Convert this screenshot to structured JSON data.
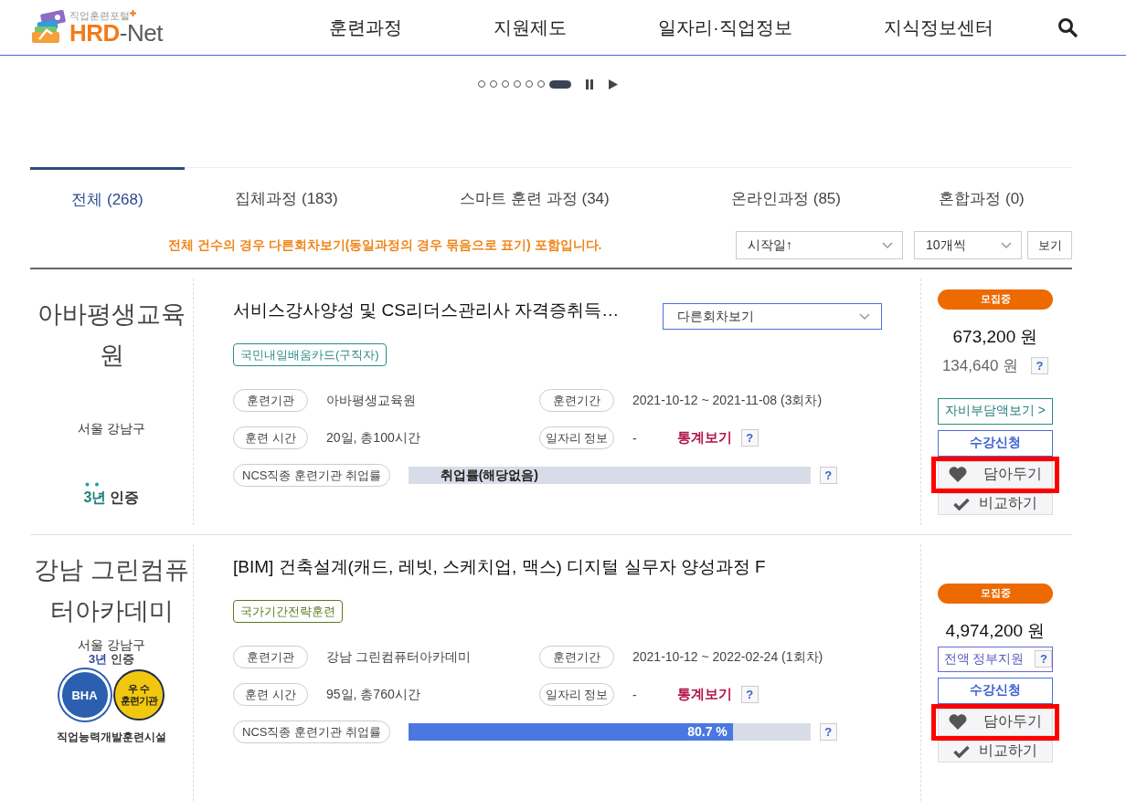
{
  "header": {
    "logo_subtitle": "직업훈련포털",
    "logo_brand": "HRD",
    "logo_suffix": "-Net",
    "nav": [
      "훈련과정",
      "지원제도",
      "일자리·직업정보",
      "지식정보센터"
    ]
  },
  "carousel": {
    "dots": [
      {
        "selected": false
      },
      {
        "selected": false
      },
      {
        "selected": false
      },
      {
        "selected": false
      },
      {
        "selected": false
      },
      {
        "selected": false
      },
      {
        "selected": true
      }
    ]
  },
  "tabs": [
    {
      "label": "전체 (268)",
      "selected": true
    },
    {
      "label": "집체과정 (183)",
      "selected": false
    },
    {
      "label": "스마트 훈련 과정 (34)",
      "selected": false
    },
    {
      "label": "온라인과정 (85)",
      "selected": false
    },
    {
      "label": "혼합과정 (0)",
      "selected": false
    }
  ],
  "notice": "전체 건수의 경우 다른회차보기(동일과정의 경우 묶음으로 표기) 포함입니다.",
  "sort": {
    "order": "시작일↑",
    "page_size": "10개씩",
    "button": "보기"
  },
  "courses": [
    {
      "institution": "아바평생교육원",
      "location": "서울 강남구",
      "certification": {
        "kind": "dotted",
        "years": "3년",
        "label": "인증"
      },
      "title": "서비스강사양성 및 CS리더스관리사 자격증취득…",
      "other_rounds": "다른회차보기",
      "tag": {
        "label": "국민내일배움카드(구직자)",
        "color": "#2b8a86"
      },
      "info": [
        {
          "label": "훈련기관",
          "value": "아바평생교육원"
        },
        {
          "label": "훈련기간",
          "value": "2021-10-12 ~ 2021-11-08 (3회차)"
        },
        {
          "label": "훈련 시간",
          "value": "20일, 총100시간"
        },
        {
          "label": "일자리 정보",
          "value": "-"
        }
      ],
      "stats_link": "통계보기",
      "stats_help": "?",
      "employment": {
        "label": "NCS직종 훈련기관 취업률",
        "level": 0,
        "reading": "취업률(해당없음)",
        "help": "?"
      },
      "status": "모집중",
      "price": "673,200 원",
      "self_pay": "134,640 원",
      "self_pay_help": "?",
      "self_pay_button": "자비부담액보기 >",
      "apply": "수강신청",
      "save": "담아두기",
      "compare": "비교하기",
      "highlighted": true
    },
    {
      "institution": "강남 그린컴퓨터아카데미",
      "location": "서울 강남구",
      "certification": {
        "kind": "plain",
        "years": "3년",
        "label": "인증"
      },
      "badges": [
        {
          "kind": "bha",
          "text": "BHA"
        },
        {
          "kind": "excellent",
          "text": "우 수\n훈련기관"
        }
      ],
      "facility": "직업능력개발훈련시설",
      "title": "[BIM] 건축설계(캐드, 레빗, 스케치업, 맥스) 디지털 실무자 양성과정 F",
      "tag": {
        "label": "국가기간전략훈련",
        "color": "#5b7a1f"
      },
      "info": [
        {
          "label": "훈련기관",
          "value": "강남 그린컴퓨터아카데미"
        },
        {
          "label": "훈련기간",
          "value": "2021-10-12 ~ 2022-02-24 (1회차)"
        },
        {
          "label": "훈련 시간",
          "value": "95일, 총760시간"
        },
        {
          "label": "일자리 정보",
          "value": "-"
        }
      ],
      "stats_link": "통계보기",
      "stats_help": "?",
      "employment": {
        "label": "NCS직종 훈련기관 취업률",
        "level": 0.807,
        "reading": "80.7 %",
        "help": "?"
      },
      "status": "모집중",
      "price": "4,974,200 원",
      "support": "전액 정부지원",
      "support_help": "?",
      "apply": "수강신청",
      "save": "담아두기",
      "compare": "비교하기",
      "highlighted": true
    }
  ]
}
